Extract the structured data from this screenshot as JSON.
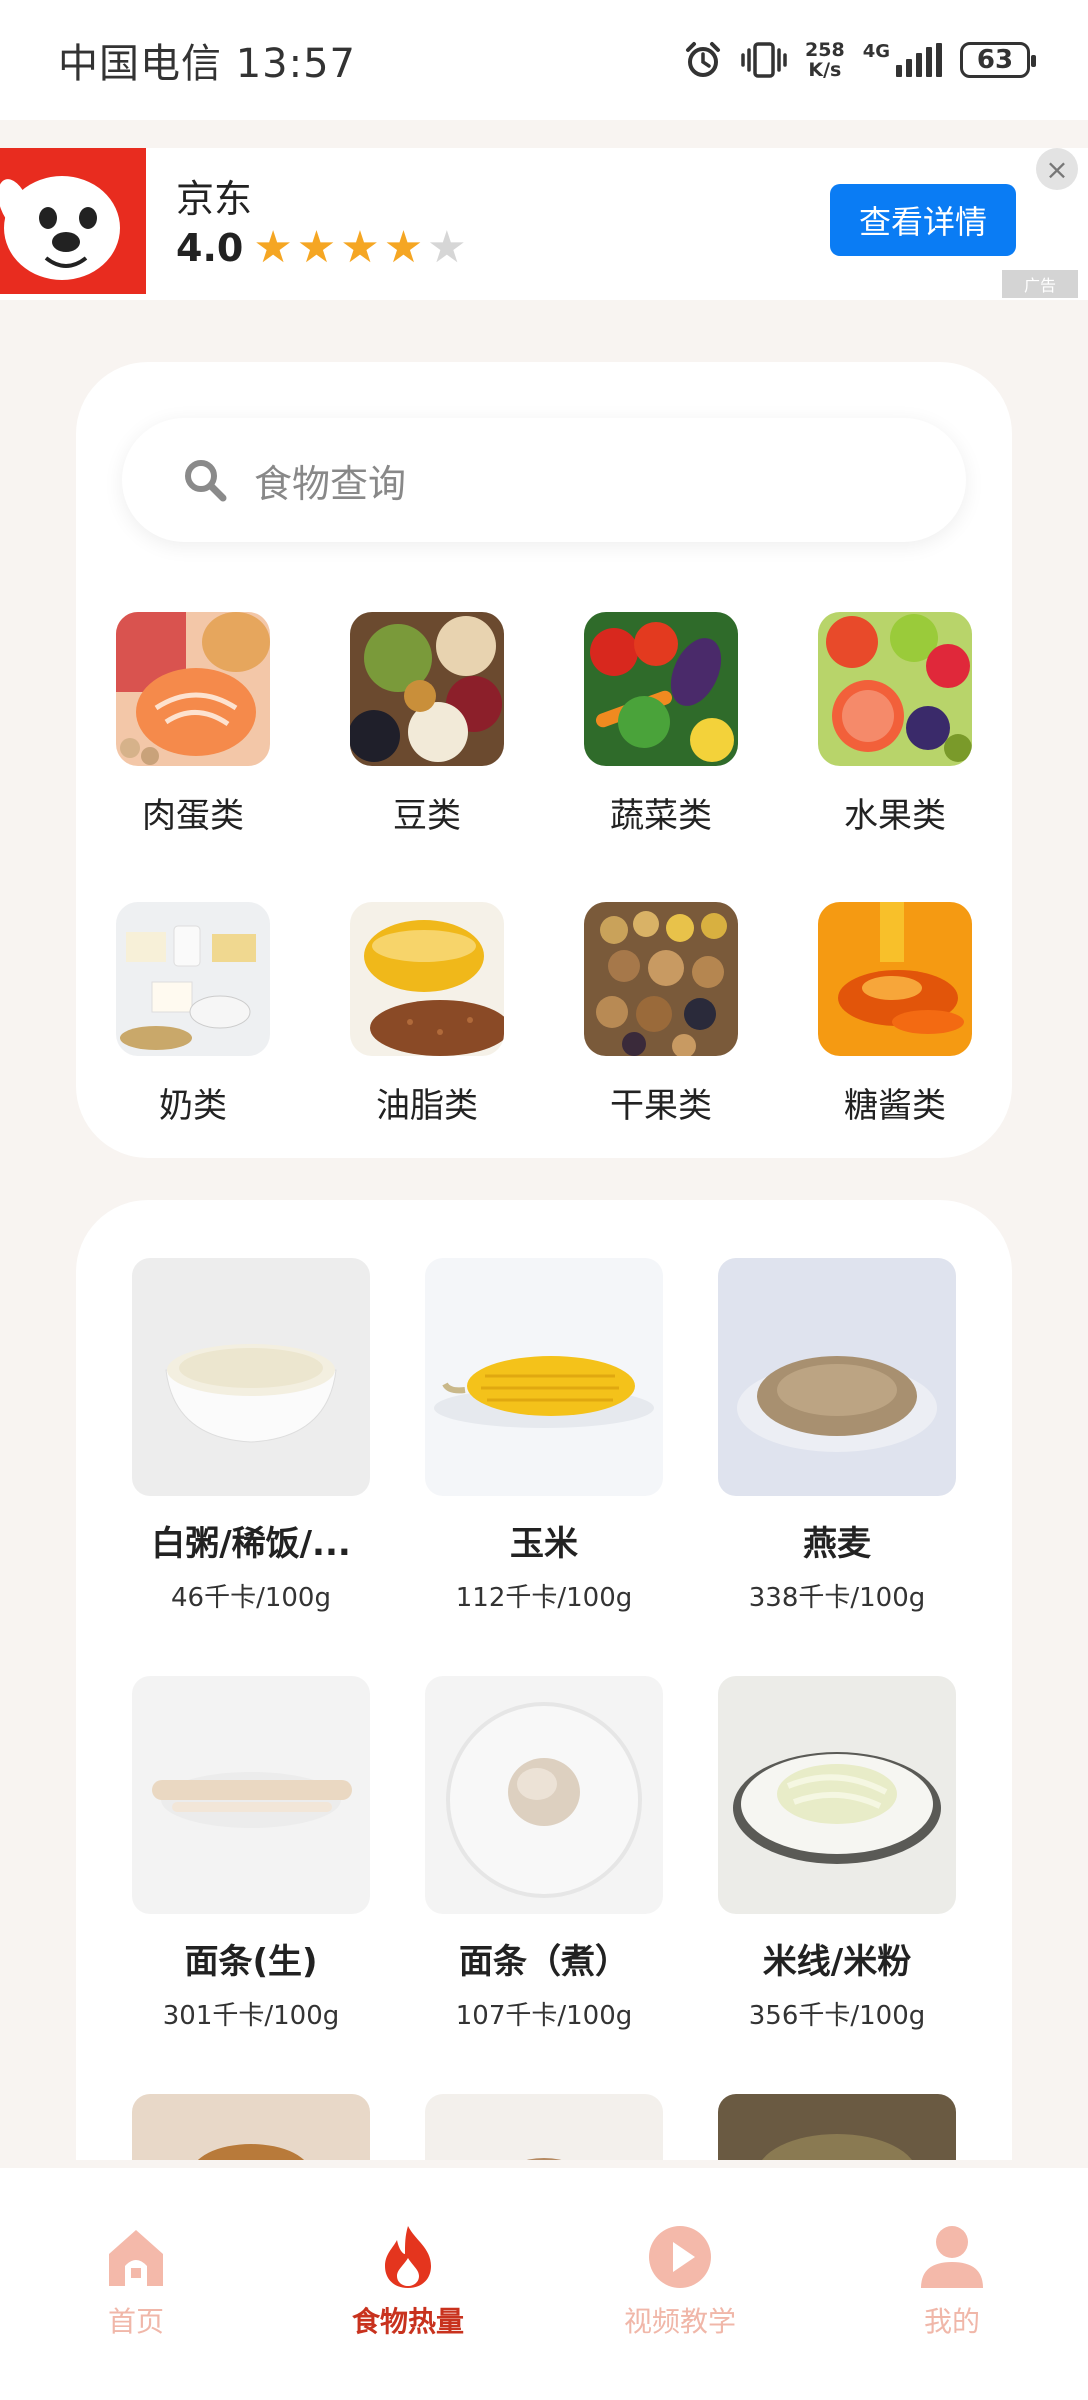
{
  "status_bar": {
    "carrier_time": "中国电信 13:57",
    "speed_value": "258",
    "speed_unit": "K/s",
    "network": "4G",
    "battery": "63"
  },
  "ad": {
    "title": "京东",
    "rating": "4.0",
    "rating_value": 4,
    "rating_max": 5,
    "button_label": "查看详情",
    "ad_mark": "广告",
    "brand_color": "#e82c1f",
    "button_color": "#0a7cf4"
  },
  "search": {
    "placeholder": "食物查询"
  },
  "categories": [
    {
      "label": "肉蛋类",
      "icon": "meat-eggs-photo"
    },
    {
      "label": "豆类",
      "icon": "beans-photo"
    },
    {
      "label": "蔬菜类",
      "icon": "vegetables-photo"
    },
    {
      "label": "水果类",
      "icon": "fruits-photo"
    },
    {
      "label": "奶类",
      "icon": "dairy-photo"
    },
    {
      "label": "油脂类",
      "icon": "oil-photo"
    },
    {
      "label": "干果类",
      "icon": "nuts-photo"
    },
    {
      "label": "糖酱类",
      "icon": "honey-photo"
    }
  ],
  "foods": [
    {
      "name": "白粥/稀饭/...",
      "kcal": "46千卡/100g",
      "icon": "congee-photo"
    },
    {
      "name": "玉米",
      "kcal": "112千卡/100g",
      "icon": "corn-photo"
    },
    {
      "name": "燕麦",
      "kcal": "338千卡/100g",
      "icon": "oats-photo"
    },
    {
      "name": "面条(生)",
      "kcal": "301千卡/100g",
      "icon": "raw-noodles-photo"
    },
    {
      "name": "面条（煮）",
      "kcal": "107千卡/100g",
      "icon": "cooked-noodles-photo"
    },
    {
      "name": "米线/米粉",
      "kcal": "356千卡/100g",
      "icon": "rice-noodles-photo"
    },
    {
      "name": "",
      "kcal": "",
      "icon": "food-photo"
    },
    {
      "name": "",
      "kcal": "",
      "icon": "food-photo"
    },
    {
      "name": "",
      "kcal": "",
      "icon": "food-photo"
    }
  ],
  "tabs": [
    {
      "label": "首页",
      "icon": "home-icon"
    },
    {
      "label": "食物热量",
      "icon": "flame-icon",
      "active": true
    },
    {
      "label": "视频教学",
      "icon": "play-icon"
    },
    {
      "label": "我的",
      "icon": "person-icon"
    }
  ],
  "colors": {
    "tab_active": "#c8321e",
    "tab_inactive": "#f0b7a9",
    "star": "#f5a623",
    "page_bg": "#f8f4f1"
  }
}
